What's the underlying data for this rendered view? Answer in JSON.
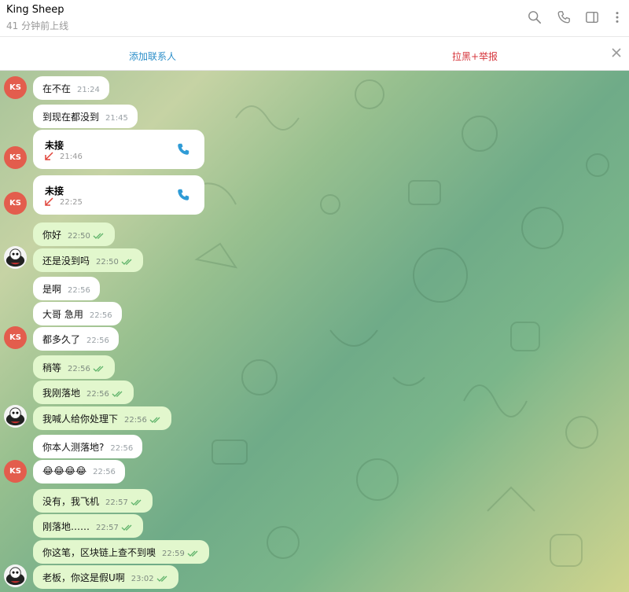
{
  "header": {
    "title": "King Sheep",
    "status": "41 分钟前上线",
    "icons": [
      "search-icon",
      "phone-icon",
      "sidebar-toggle-icon",
      "more-vertical-icon"
    ]
  },
  "actionbar": {
    "add_contact": "添加联系人",
    "block_report": "拉黑+举报",
    "close_icon": "close-icon"
  },
  "contact": {
    "initials": "KS",
    "avatar_color": "#e35d4d"
  },
  "colors": {
    "outgoing_bubble": "#e2f7cd",
    "incoming_bubble": "#ffffff",
    "link": "#2b8ec9",
    "danger": "#d6363c",
    "missed_call": "#e0443a"
  },
  "messages": [
    {
      "dir": "in",
      "text": "在不在",
      "time": "21:24"
    },
    {
      "dir": "in",
      "text": "到现在都没到",
      "time": "21:45"
    },
    {
      "dir": "in",
      "type": "call",
      "text": "未接",
      "time": "21:46"
    },
    {
      "dir": "in",
      "type": "call",
      "text": "未接",
      "time": "22:25"
    },
    {
      "dir": "out",
      "text": "你好",
      "time": "22:50"
    },
    {
      "dir": "out",
      "text": "还是没到吗",
      "time": "22:50"
    },
    {
      "dir": "in",
      "text": "是啊",
      "time": "22:56"
    },
    {
      "dir": "in",
      "text": "大哥 急用",
      "time": "22:56"
    },
    {
      "dir": "in",
      "text": "都多久了",
      "time": "22:56"
    },
    {
      "dir": "out",
      "text": "稍等",
      "time": "22:56"
    },
    {
      "dir": "out",
      "text": "我刚落地",
      "time": "22:56"
    },
    {
      "dir": "out",
      "text": "我喊人给你处理下",
      "time": "22:56"
    },
    {
      "dir": "in",
      "text": "你本人测落地?",
      "time": "22:56"
    },
    {
      "dir": "in",
      "text": "😂😂😂😂",
      "time": "22:56"
    },
    {
      "dir": "out",
      "text": "没有，我飞机",
      "time": "22:57"
    },
    {
      "dir": "out",
      "text": "刚落地……",
      "time": "22:57"
    },
    {
      "dir": "out",
      "text": "你这笔，区块链上查不到噢",
      "time": "22:59"
    },
    {
      "dir": "out",
      "text": "老板，你这是假U啊",
      "time": "23:02"
    }
  ]
}
